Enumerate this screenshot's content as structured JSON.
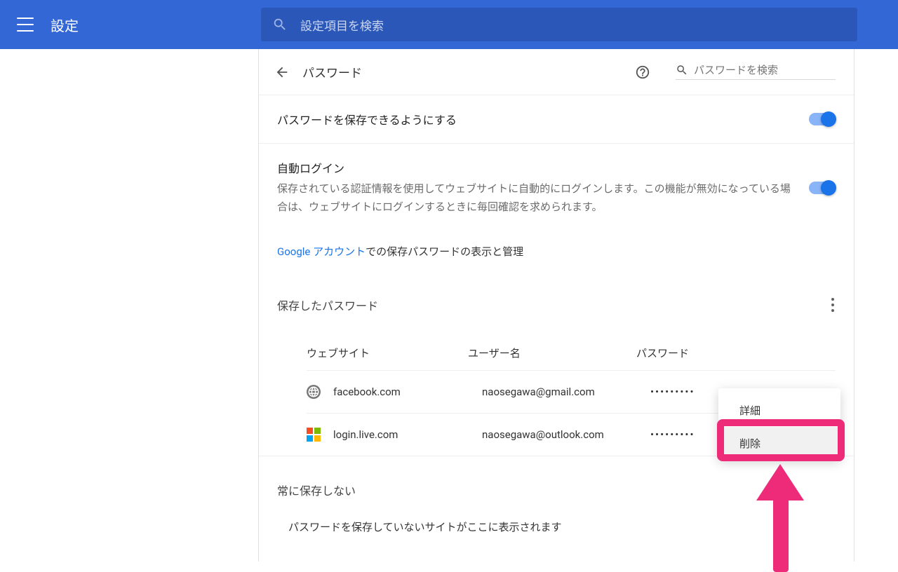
{
  "toolbar": {
    "title": "設定",
    "search_placeholder": "設定項目を検索"
  },
  "page": {
    "title": "パスワード",
    "search_placeholder": "パスワードを検索"
  },
  "options": {
    "save_passwords": {
      "label": "パスワードを保存できるようにする",
      "enabled": true
    },
    "auto_signin": {
      "label": "自動ログイン",
      "description": "保存されている認証情報を使用してウェブサイトに自動的にログインします。この機能が無効になっている場合は、ウェブサイトにログインするときに毎回確認を求められます。",
      "enabled": true
    }
  },
  "google_link": {
    "link_text": "Google アカウント",
    "suffix_text": "での保存パスワードの表示と管理"
  },
  "saved": {
    "section_title": "保存したパスワード",
    "columns": {
      "site": "ウェブサイト",
      "user": "ユーザー名",
      "password": "パスワード"
    },
    "rows": [
      {
        "site": "facebook.com",
        "user": "naosegawa@gmail.com",
        "password_mask": "•••••••••",
        "icon": "globe-icon"
      },
      {
        "site": "login.live.com",
        "user": "naosegawa@outlook.com",
        "password_mask": "•••••••••",
        "icon": "microsoft-icon"
      }
    ]
  },
  "never": {
    "section_title": "常に保存しない",
    "empty_text": "パスワードを保存していないサイトがここに表示されます"
  },
  "context_menu": {
    "items": [
      {
        "label": "詳細"
      },
      {
        "label": "削除"
      }
    ]
  }
}
